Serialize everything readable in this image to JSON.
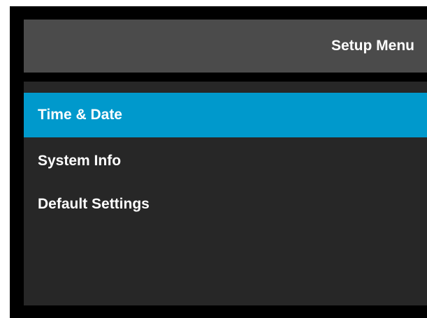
{
  "header": {
    "title": "Setup Menu"
  },
  "menu": {
    "items": [
      {
        "label": "Time & Date",
        "selected": true
      },
      {
        "label": "System Info",
        "selected": false
      },
      {
        "label": "Default Settings",
        "selected": false
      }
    ]
  },
  "colors": {
    "background": "#000000",
    "title_bar": "#4b4b4b",
    "panel": "#272727",
    "selected": "#0099cc",
    "text": "#ffffff"
  }
}
